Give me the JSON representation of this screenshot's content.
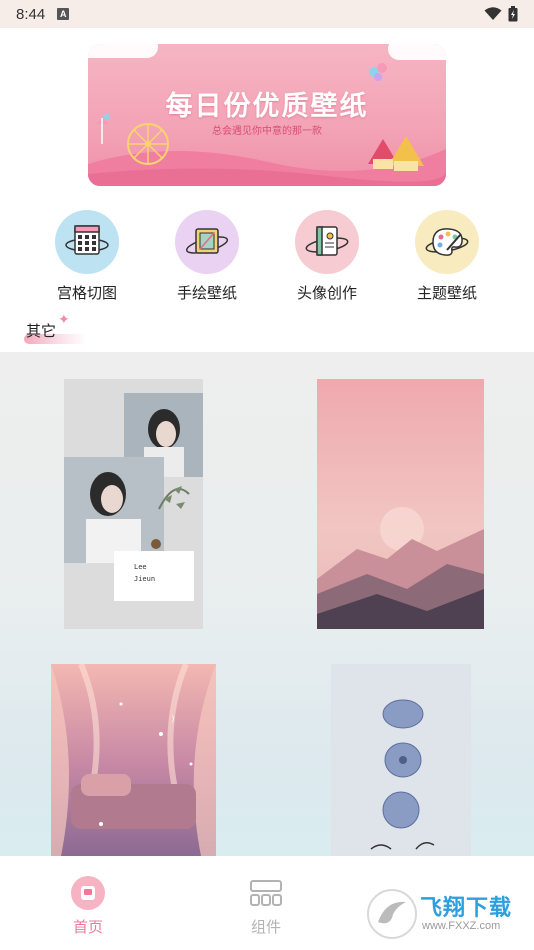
{
  "status_bar": {
    "time": "8:44",
    "notification_icon": "A"
  },
  "banner": {
    "title": "每日份优质壁纸",
    "subtitle": "总会遇见你中意的那一款"
  },
  "categories": [
    {
      "label": "宫格切图",
      "icon": "grid-calendar-icon",
      "bg": "#bde3f3"
    },
    {
      "label": "手绘壁纸",
      "icon": "hand-drawn-frame-icon",
      "bg": "#ead2f3"
    },
    {
      "label": "头像创作",
      "icon": "notebook-icon",
      "bg": "#f6ccd2"
    },
    {
      "label": "主题壁纸",
      "icon": "palette-icon",
      "bg": "#f7ebbf"
    }
  ],
  "section": {
    "title": "其它"
  },
  "bottom_nav": [
    {
      "label": "首页",
      "active": true,
      "icon": "home-icon"
    },
    {
      "label": "组件",
      "active": false,
      "icon": "widgets-icon"
    }
  ],
  "watermark": {
    "brand": "飞翔下载",
    "url": "www.FXXZ.com"
  },
  "colors": {
    "accent": "#f27799",
    "inactive": "#b3b3b3"
  }
}
